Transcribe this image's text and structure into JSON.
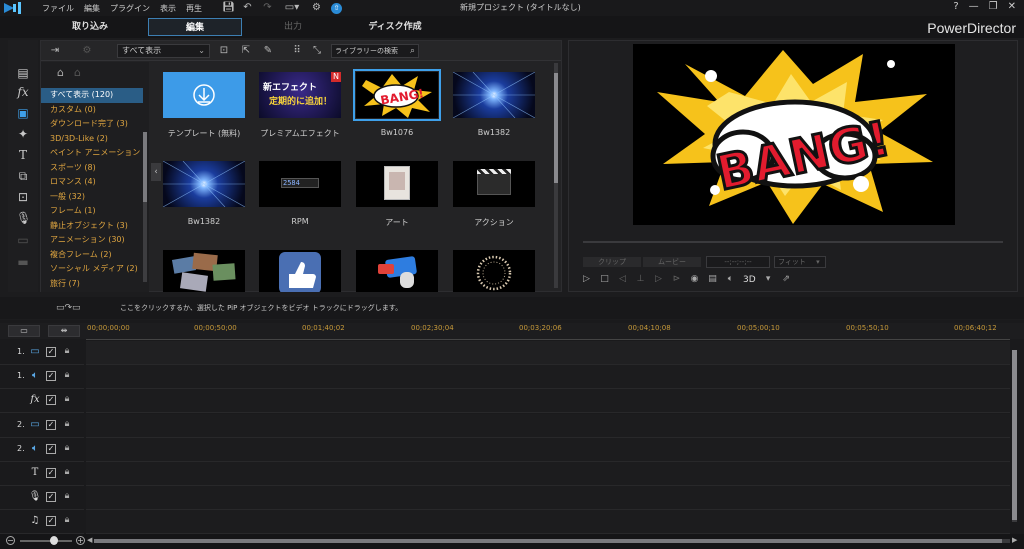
{
  "app": {
    "window_title": "新規プロジェクト (タイトルなし)",
    "brand": "PowerDirector",
    "menu": [
      "ファイル",
      "編集",
      "プラグイン",
      "表示",
      "再生"
    ],
    "window_controls": [
      "?",
      "—",
      "❐",
      "✕"
    ]
  },
  "modes": {
    "capture": "取り込み",
    "edit": "編集",
    "output": "出力",
    "disc": "ディスク作成",
    "active": "編集"
  },
  "library": {
    "filter_value": "すべて表示",
    "search_placeholder": "ライブラリーの検索",
    "categories": [
      "すべて表示 (120)",
      "カスタム (0)",
      "ダウンロード完了 (3)",
      "3D/3D-Like (2)",
      "ペイント アニメーション (14)",
      "スポーツ (8)",
      "ロマンス (4)",
      "一般 (32)",
      "フレーム (1)",
      "静止オブジェクト (3)",
      "アニメーション (30)",
      "複合フレーム (2)",
      "ソーシャル メディア (2)",
      "旅行 (7)"
    ],
    "selected_category": "すべて表示 (120)",
    "items": [
      {
        "label": "テンプレート (無料)",
        "thumb": "download"
      },
      {
        "label": "プレミアムエフェクト",
        "thumb": "premium",
        "badge": "N",
        "promo_line1": "新エフェクト",
        "promo_line2": "定期的に追加！"
      },
      {
        "label": "Bw1076",
        "thumb": "bang",
        "selected": true,
        "text": "BANG!"
      },
      {
        "label": "Bw1382",
        "thumb": "burst"
      },
      {
        "label": "Bw1382",
        "thumb": "burst"
      },
      {
        "label": "RPM",
        "thumb": "rpm",
        "text": "2584"
      },
      {
        "label": "アート",
        "thumb": "art"
      },
      {
        "label": "アクション",
        "thumb": "action"
      },
      {
        "label": "",
        "thumb": "collage"
      },
      {
        "label": "",
        "thumb": "thumbsup"
      },
      {
        "label": "",
        "thumb": "card"
      },
      {
        "label": "",
        "thumb": "ring"
      }
    ]
  },
  "preview": {
    "screen_text": "BANG!",
    "clip_toggle": "クリップ",
    "movie_toggle": "ムービー",
    "timecode": "--;--;--;--",
    "fit": "フィット",
    "mode_3d": "3D"
  },
  "hint": "ここをクリックするか、選択した PiP オブジェクトをビデオ トラックにドラッグします。",
  "timeline": {
    "timecodes": [
      "00;00;00;00",
      "00;00;50;00",
      "00;01;40;02",
      "00;02;30;04",
      "00;03;20;06",
      "00;04;10;08",
      "00;05;00;10",
      "00;05;50;10",
      "00;06;40;12"
    ],
    "tracks": [
      {
        "num": "1.",
        "icon": "video-track-icon",
        "glyph": "▭"
      },
      {
        "num": "1.",
        "icon": "audio-track-icon",
        "glyph": "🔈︎"
      },
      {
        "num": "",
        "icon": "fx-track-icon",
        "glyph": "fx"
      },
      {
        "num": "2.",
        "icon": "video-track-icon",
        "glyph": "▭"
      },
      {
        "num": "2.",
        "icon": "audio-track-icon",
        "glyph": "🔈︎"
      },
      {
        "num": "",
        "icon": "title-track-icon",
        "glyph": "T"
      },
      {
        "num": "",
        "icon": "voice-track-icon",
        "glyph": "🎙︎"
      },
      {
        "num": "",
        "icon": "music-track-icon",
        "glyph": "♫"
      }
    ]
  },
  "colors": {
    "accent": "#3ea0ea",
    "category_text": "#e0a640",
    "timecode": "#c79a3a",
    "selected_bg": "#2a5d86"
  }
}
